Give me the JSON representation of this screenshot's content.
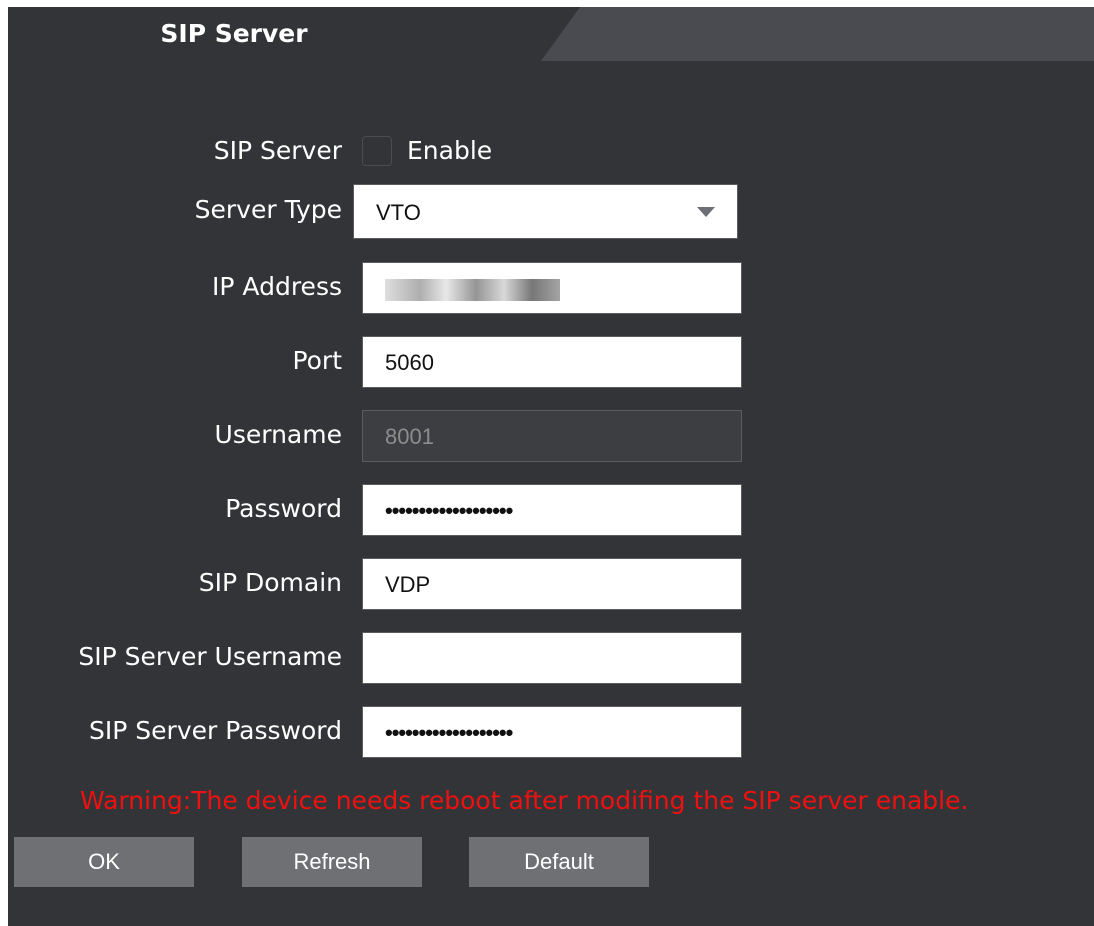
{
  "section": {
    "title": "SIP Server"
  },
  "form": {
    "sip_server": {
      "label": "SIP Server",
      "checkbox_label": "Enable",
      "checked": false
    },
    "server_type": {
      "label": "Server Type",
      "value": "VTO"
    },
    "ip_address": {
      "label": "IP Address",
      "value": ""
    },
    "port": {
      "label": "Port",
      "value": "5060"
    },
    "username": {
      "label": "Username",
      "value": "8001"
    },
    "password": {
      "label": "Password",
      "value": "•••••••••••••••••••"
    },
    "sip_domain": {
      "label": "SIP Domain",
      "value": "VDP"
    },
    "sip_server_username": {
      "label": "SIP Server Username",
      "value": ""
    },
    "sip_server_password": {
      "label": "SIP Server Password",
      "value": "•••••••••••••••••••"
    }
  },
  "warning": "Warning:The device needs reboot after modifing the SIP server enable.",
  "buttons": {
    "ok": "OK",
    "refresh": "Refresh",
    "default": "Default"
  },
  "colors": {
    "panel_bg": "#333437",
    "tab_bg": "#4a4b50",
    "warning": "#ee1111",
    "button_bg": "#6f7074"
  }
}
